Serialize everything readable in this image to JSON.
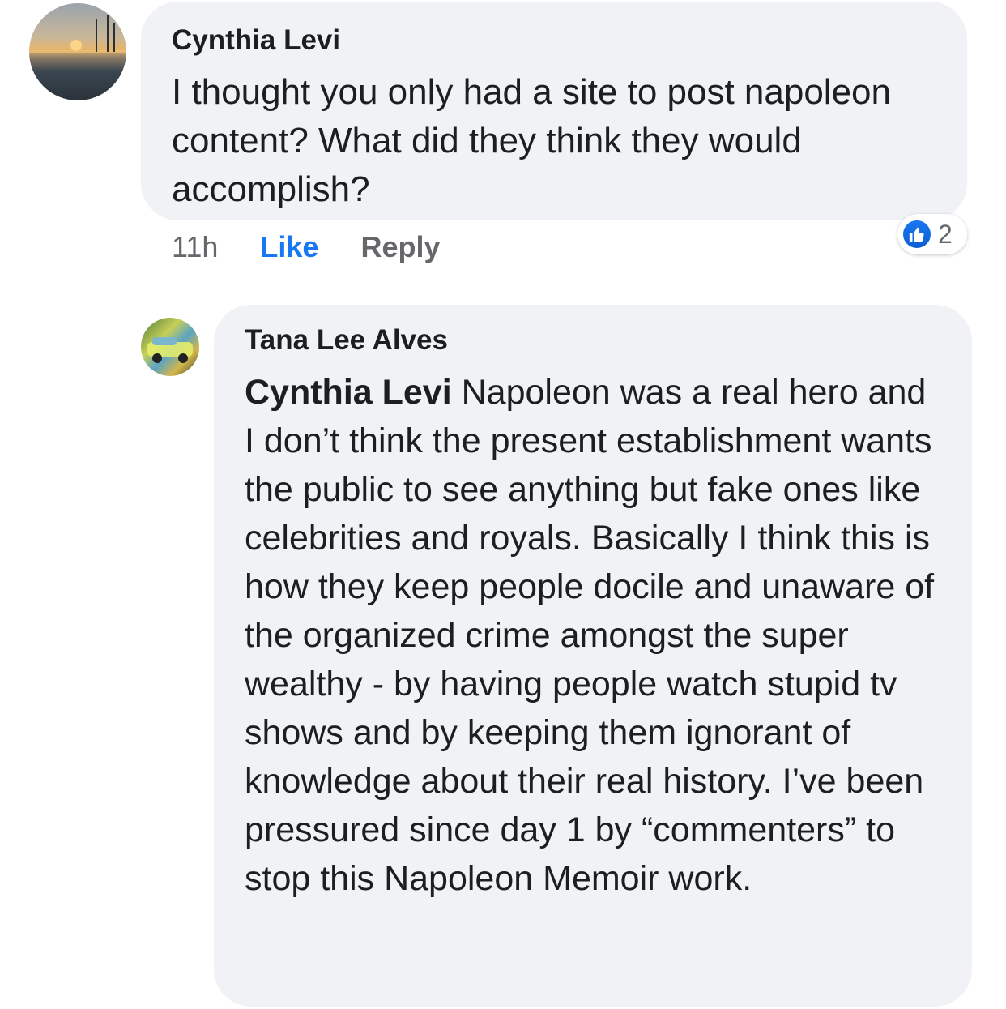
{
  "comments": [
    {
      "author": "Cynthia Levi",
      "text": "I thought you only had a site to post napoleon content? What did they think they would accomplish?",
      "time": "11h",
      "like_label": "Like",
      "reply_label": "Reply",
      "reaction_count": "2"
    },
    {
      "author": "Tana Lee Alves",
      "mention": "Cynthia Levi",
      "text": "Napoleon was a real hero and I don’t think the present establishment wants the public to see anything but fake ones like celebrities and royals. Basically I think this is how they keep people docile and unaware of the organized crime amongst the super wealthy - by having people watch stupid tv shows and by keeping them ignorant of knowledge about their real history. I’ve been pressured since day 1 by “commenters” to stop this Napoleon Memoir work."
    }
  ],
  "colors": {
    "bubble": "#f0f2f5",
    "like_blue": "#1877f2",
    "meta_gray": "#65676b"
  },
  "icons": {
    "reaction": "thumbs-up-icon"
  }
}
